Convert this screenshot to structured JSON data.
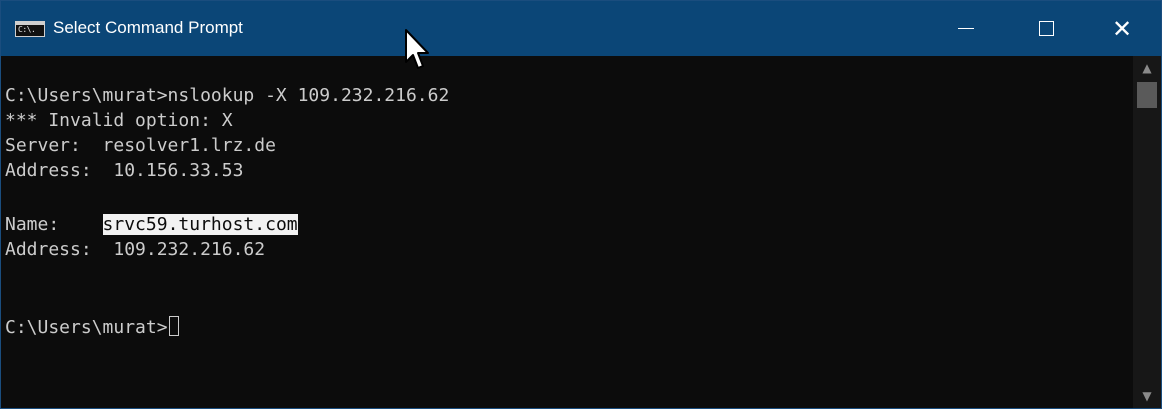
{
  "window": {
    "title": "Select Command Prompt",
    "icon": "cmd-icon",
    "icon_text": "C:\\."
  },
  "controls": {
    "minimize": "minimize-icon",
    "maximize": "maximize-icon",
    "close": "close-icon",
    "close_glyph": "✕"
  },
  "console": {
    "lines": [
      "C:\\Users\\murat>nslookup -X 109.232.216.62",
      "*** Invalid option: X",
      "Server:  resolver1.lrz.de",
      "Address:  10.156.33.53",
      "",
      "Name:    ",
      "Address:  109.232.216.62",
      "",
      "",
      "C:\\Users\\murat>"
    ],
    "name_selected": "srvc59.turhost.com"
  },
  "scrollbar": {
    "up_glyph": "▲",
    "down_glyph": "▼"
  },
  "colors": {
    "titlebar": "#0b4677",
    "background": "#0c0c0c",
    "text": "#cccccc"
  }
}
